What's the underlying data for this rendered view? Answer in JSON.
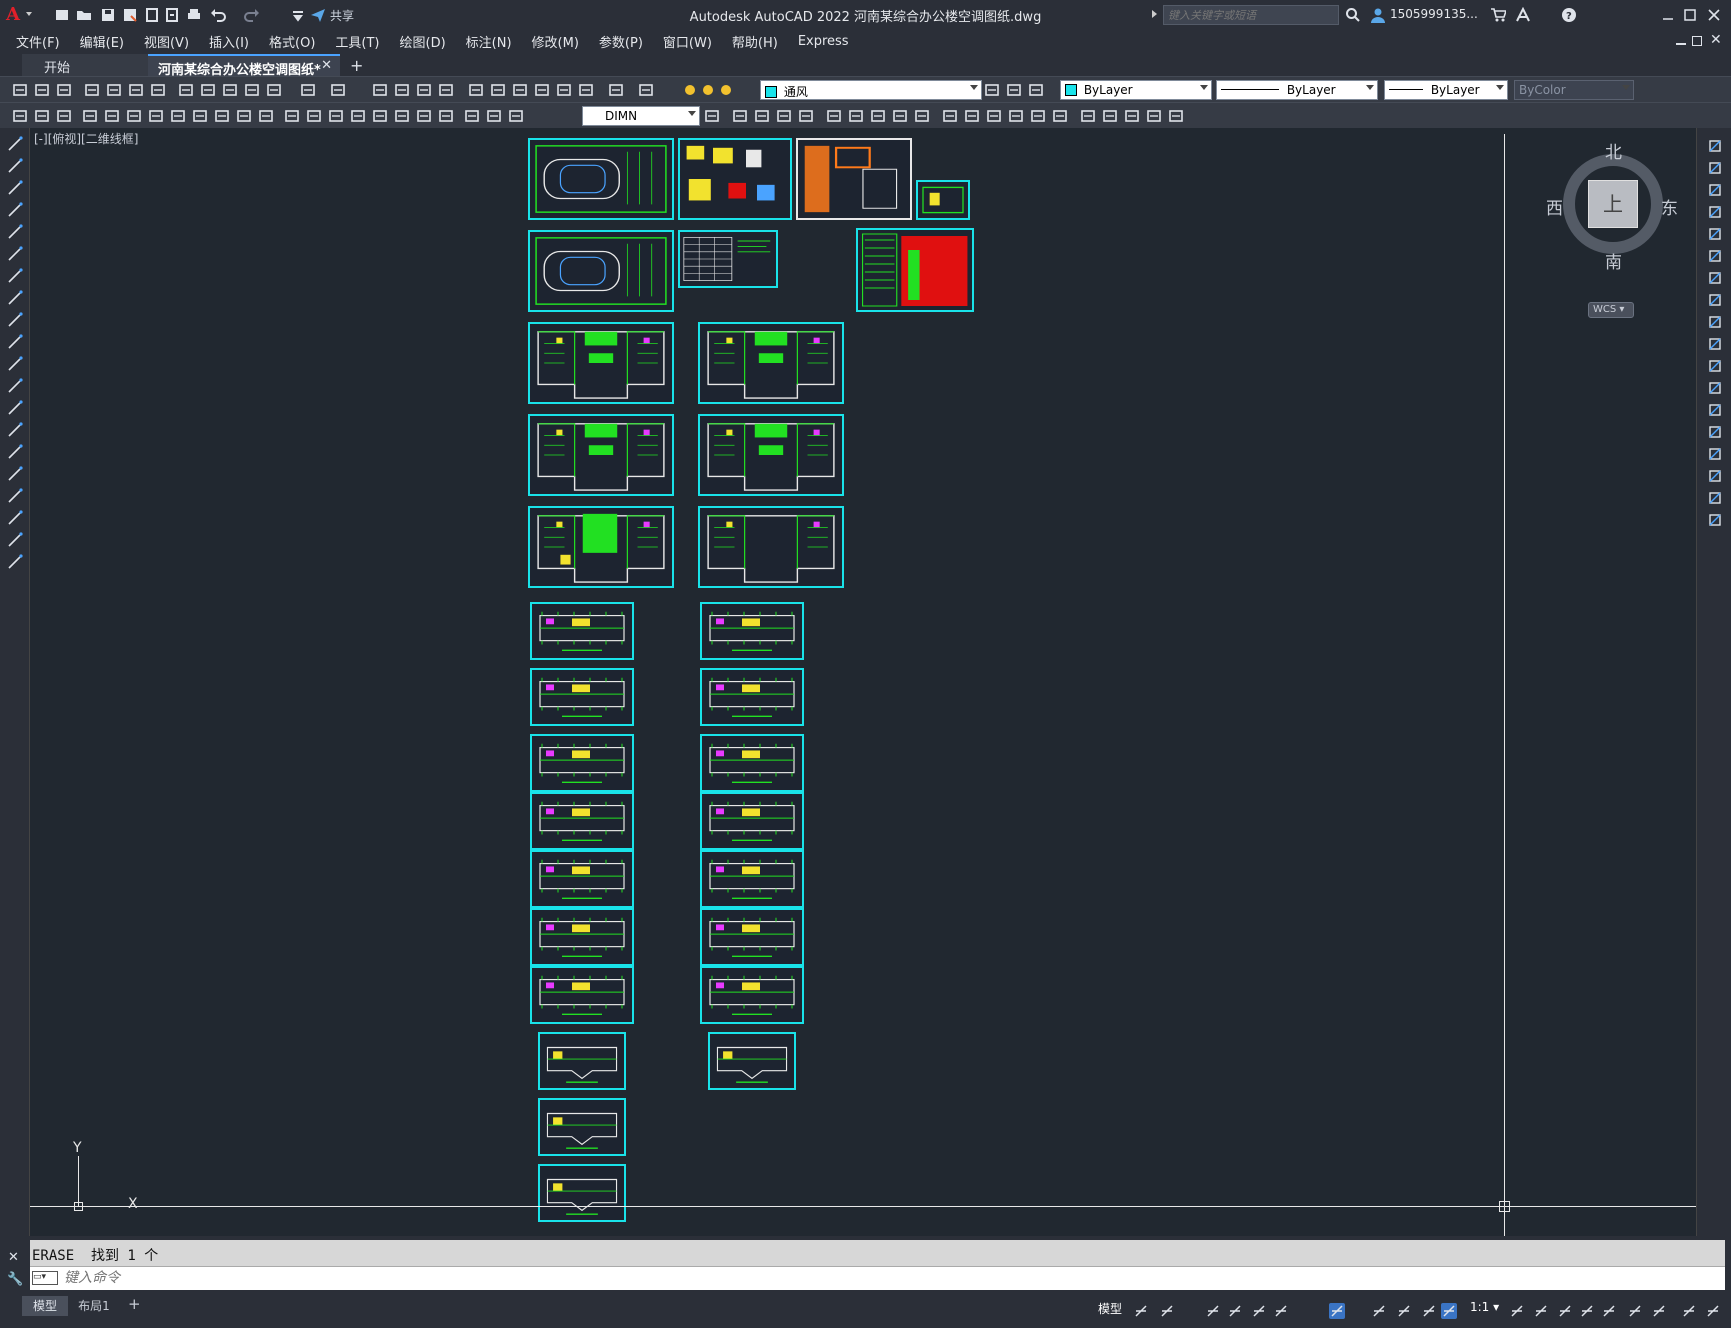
{
  "titlebar": {
    "title": "Autodesk AutoCAD 2022    河南某综合办公楼空调图纸.dwg",
    "share_label": "共享",
    "search_placeholder": "键入关键字或短语",
    "user": "1505999135...",
    "app_menu": "A"
  },
  "menu": [
    "文件(F)",
    "编辑(E)",
    "视图(V)",
    "插入(I)",
    "格式(O)",
    "工具(T)",
    "绘图(D)",
    "标注(N)",
    "修改(M)",
    "参数(P)",
    "窗口(W)",
    "帮助(H)",
    "Express"
  ],
  "tabs": {
    "start": "开始",
    "document": "河南某综合办公楼空调图纸*"
  },
  "toolbar1": {
    "layer_name": "通风",
    "color": "ByLayer",
    "linetype": "ByLayer",
    "lineweight": "ByLayer",
    "plotstyle": "ByColor"
  },
  "toolbar2": {
    "dimstyle": "DIMN"
  },
  "viewport": {
    "label": "[-][俯视][二维线框]",
    "viewcube": {
      "north": "北",
      "south": "南",
      "east": "东",
      "west": "西",
      "face": "上",
      "wcs": "WCS"
    },
    "ucs": {
      "x": "X",
      "y": "Y"
    }
  },
  "command": {
    "history": "ERASE  找到 1 个",
    "input_placeholder": "键入命令"
  },
  "layout_tabs": [
    "模型",
    "布局1"
  ],
  "statusbar": {
    "model": "模型",
    "scale": "1:1"
  },
  "colors": {
    "frame": "#19e3ea",
    "drawing_green": "#22e022",
    "canvas_bg": "#212830"
  }
}
